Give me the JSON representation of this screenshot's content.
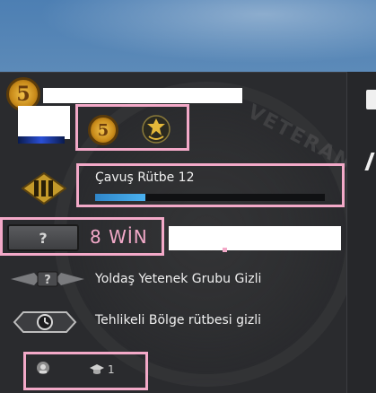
{
  "profile": {
    "level": "5",
    "medals": [
      {
        "name": "service-medal-coin",
        "text": "5"
      },
      {
        "name": "veteran-badge"
      }
    ]
  },
  "rank": {
    "label": "Çavuş Rütbe 12",
    "progress_fraction": 0.22
  },
  "competitive": {
    "wins_label": "8 WİN",
    "rank_placeholder": "?"
  },
  "wingman": {
    "placeholder": "?",
    "label": "Yoldaş Yetenek Grubu Gizli"
  },
  "danger_zone": {
    "label": "Tehlikeli Bölge rütbesi gizli"
  },
  "footer": {
    "commendation_count": "1"
  },
  "background_emblem_text": "VETERAN",
  "colors": {
    "highlight": "#f3a9c8",
    "xp_bar": "#3a9ad9",
    "panel": "#2a2b2e"
  },
  "icons": {
    "rank": "rank-chevrons-icon",
    "wingman": "wingman-wings-icon",
    "danger_zone": "danger-zone-clock-icon",
    "footer_a": "emblem-icon",
    "footer_b": "graduation-cap-icon"
  }
}
